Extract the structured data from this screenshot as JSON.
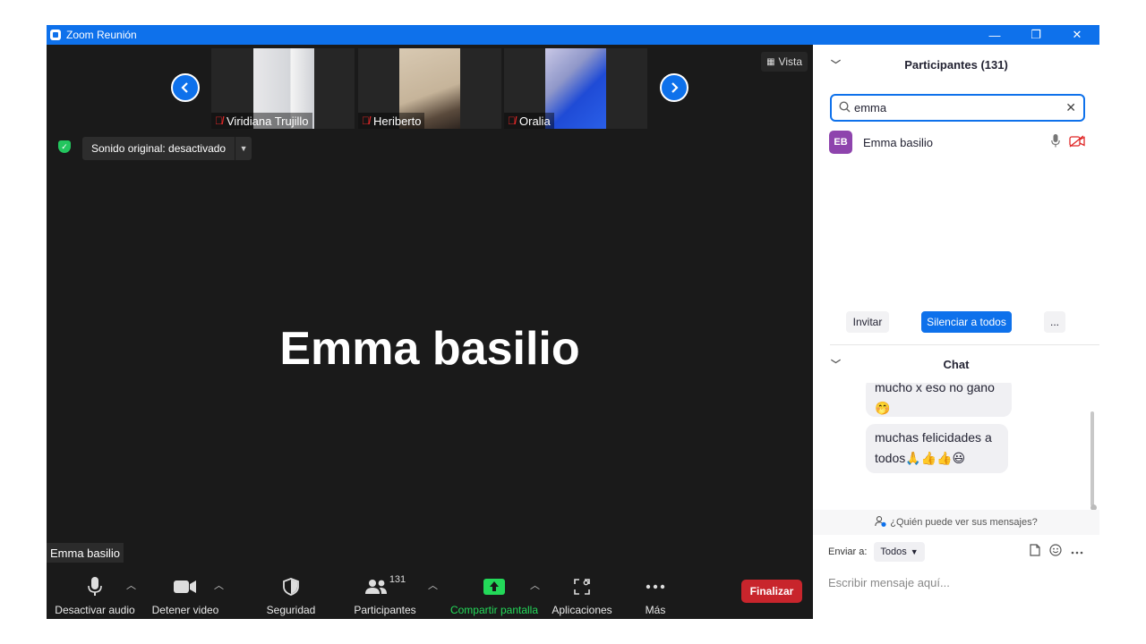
{
  "titlebar": {
    "title": "Zoom Reunión",
    "minimize": "—",
    "restore": "❐",
    "close": "✕"
  },
  "gallery": {
    "thumbs": [
      {
        "name": "Viridiana Trujillo",
        "muted": true
      },
      {
        "name": "Heriberto",
        "muted": true
      },
      {
        "name": "Oralia",
        "muted": true
      }
    ],
    "prev_icon": "chevron-left-icon",
    "next_icon": "chevron-right-icon",
    "view_label": "Vista"
  },
  "audio_banner": {
    "label": "Sonido original: desactivado"
  },
  "speaker": {
    "name": "Emma basilio",
    "badge": "Emma basilio"
  },
  "toolbar": {
    "audio": "Desactivar audio",
    "video": "Detener video",
    "security": "Seguridad",
    "participants": "Participantes",
    "participants_count": "131",
    "share": "Compartir pantalla",
    "apps": "Aplicaciones",
    "more": "Más",
    "end": "Finalizar",
    "share_color": "#23d959",
    "end_color": "#c8252c"
  },
  "participants_panel": {
    "title": "Participantes (131)",
    "search_value": "emma",
    "results": [
      {
        "initials": "EB",
        "name": "Emma basilio",
        "avatar_color": "#8e44ad"
      }
    ],
    "invite": "Invitar",
    "mute_all": "Silenciar a todos",
    "more": "..."
  },
  "chat_panel": {
    "title": "Chat",
    "messages": [
      {
        "text": "mucho x eso no gano",
        "emoji": "🤭"
      },
      {
        "text": "muchas felicidades a",
        "line2": "todos🙏👍👍😃"
      }
    ],
    "who_can_see": "¿Quién puede ver sus mensajes?",
    "send_to_label": "Enviar a:",
    "send_to_value": "Todos",
    "input_placeholder": "Escribir mensaje aquí..."
  },
  "colors": {
    "accent": "#0e71eb",
    "stage_bg": "#1a1a1a"
  }
}
